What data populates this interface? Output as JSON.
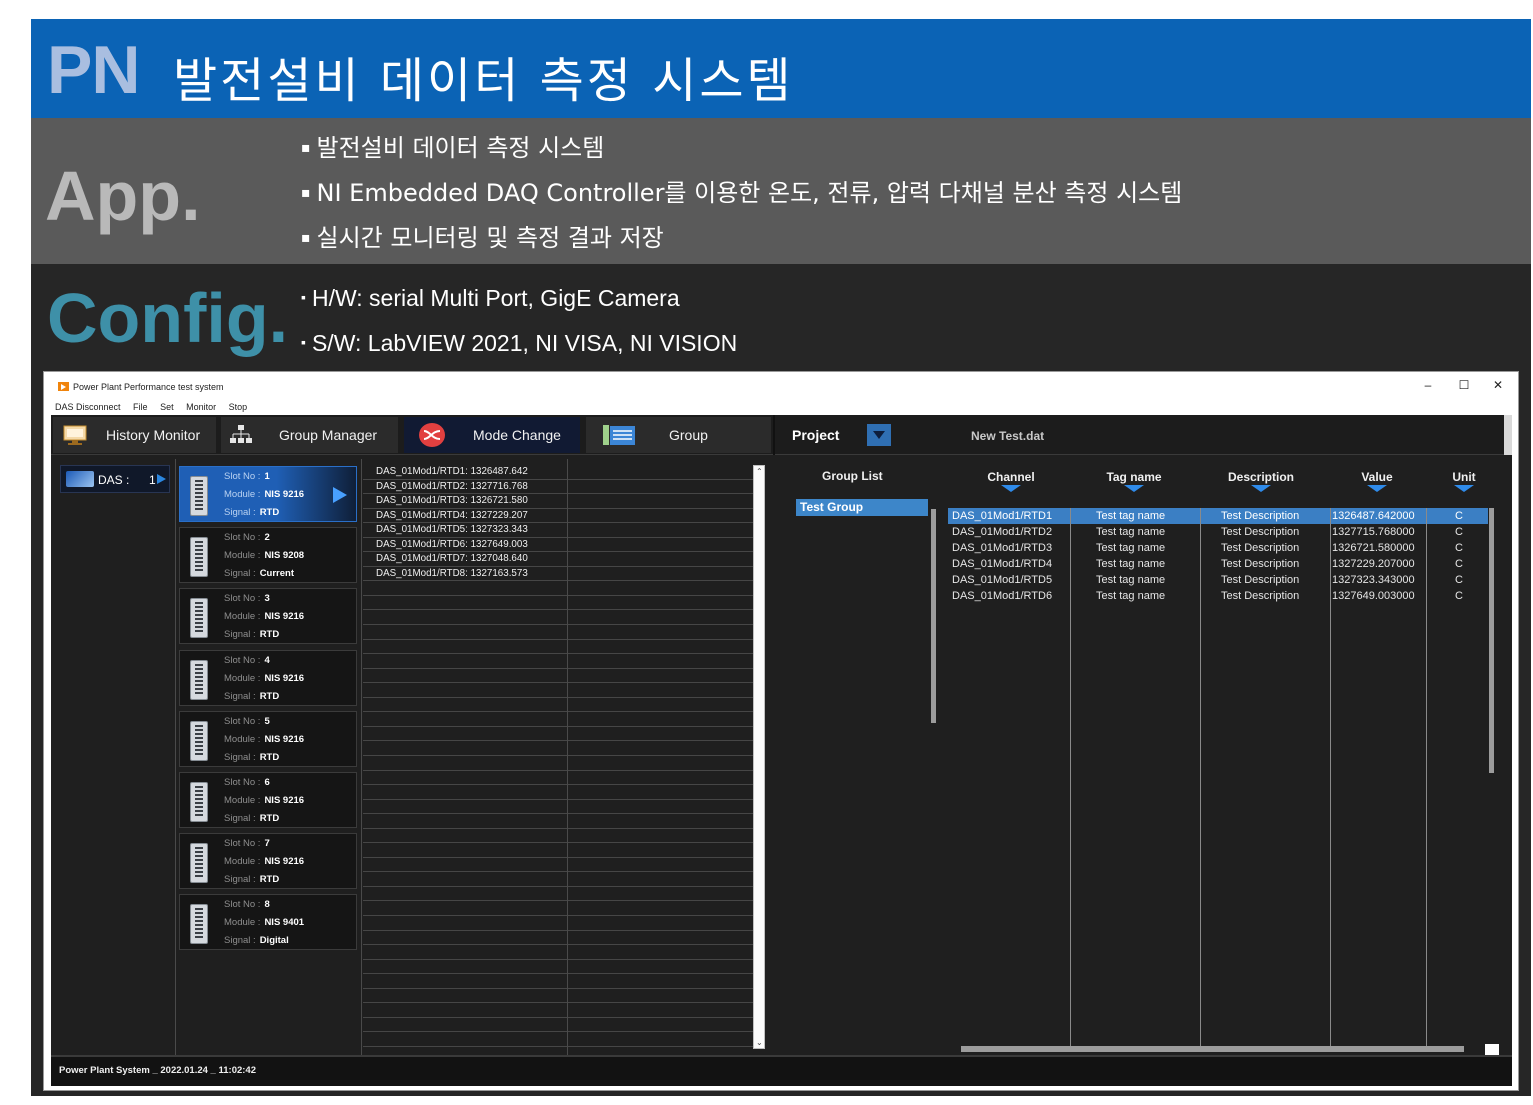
{
  "header": {
    "logo": "PN",
    "title": "발전설비 데이터 측정 시스템",
    "brand_color": "#0b63b5"
  },
  "app_section": {
    "label": "App.",
    "bullets": [
      "발전설비 데이터 측정 시스템",
      "NI Embedded  DAQ Controller를 이용한 온도, 전류, 압력 다채널 분산 측정 시스템",
      "실시간 모니터링 및 측정 결과 저장"
    ]
  },
  "config_section": {
    "label": "Config.",
    "bullets": [
      "H/W: serial Multi Port, GigE Camera",
      "S/W: LabVIEW 2021, NI VISA, NI VISION"
    ]
  },
  "window": {
    "title": "Power Plant Performance test system",
    "minimize": "–",
    "maximize": "☐",
    "close": "✕",
    "menu": [
      "DAS Disconnect",
      "File",
      "Set",
      "Monitor",
      "Stop"
    ]
  },
  "toolbar": {
    "history_monitor": "History Monitor",
    "group_manager": "Group Manager",
    "mode_change": "Mode Change",
    "group": "Group",
    "project_label": "Project",
    "project_file": "New Test.dat"
  },
  "das": {
    "label": "DAS :",
    "number": "1"
  },
  "slot_labels": {
    "slot": "Slot No :",
    "module": "Module :",
    "signal": "Signal   :"
  },
  "slots": [
    {
      "no": "1",
      "module": "NIS 9216",
      "signal": "RTD"
    },
    {
      "no": "2",
      "module": "NIS 9208",
      "signal": "Current"
    },
    {
      "no": "3",
      "module": "NIS 9216",
      "signal": "RTD"
    },
    {
      "no": "4",
      "module": "NIS 9216",
      "signal": "RTD"
    },
    {
      "no": "5",
      "module": "NIS 9216",
      "signal": "RTD"
    },
    {
      "no": "6",
      "module": "NIS 9216",
      "signal": "RTD"
    },
    {
      "no": "7",
      "module": "NIS 9216",
      "signal": "RTD"
    },
    {
      "no": "8",
      "module": "NIS 9401",
      "signal": "Digital"
    }
  ],
  "channel_values": [
    "DAS_01Mod1/RTD1:  1326487.642",
    "DAS_01Mod1/RTD2:  1327716.768",
    "DAS_01Mod1/RTD3:  1326721.580",
    "DAS_01Mod1/RTD4:  1327229.207",
    "DAS_01Mod1/RTD5:  1327323.343",
    "DAS_01Mod1/RTD6:  1327649.003",
    "DAS_01Mod1/RTD7:  1327048.640",
    "DAS_01Mod1/RTD8:  1327163.573"
  ],
  "group_list": {
    "title": "Group List",
    "items": [
      "Test Group"
    ]
  },
  "table": {
    "headers": [
      "Channel",
      "Tag name",
      "Description",
      "Value",
      "Unit"
    ],
    "rows": [
      [
        "DAS_01Mod1/RTD1",
        "Test tag name",
        "Test Description",
        "1326487.642000",
        "C"
      ],
      [
        "DAS_01Mod1/RTD2",
        "Test tag name",
        "Test Description",
        "1327715.768000",
        "C"
      ],
      [
        "DAS_01Mod1/RTD3",
        "Test tag name",
        "Test Description",
        "1326721.580000",
        "C"
      ],
      [
        "DAS_01Mod1/RTD4",
        "Test tag name",
        "Test Description",
        "1327229.207000",
        "C"
      ],
      [
        "DAS_01Mod1/RTD5",
        "Test tag name",
        "Test Description",
        "1327323.343000",
        "C"
      ],
      [
        "DAS_01Mod1/RTD6",
        "Test tag name",
        "Test Description",
        "1327649.003000",
        "C"
      ]
    ]
  },
  "status": "Power Plant System _ 2022.01.24 _ 11:02:42"
}
